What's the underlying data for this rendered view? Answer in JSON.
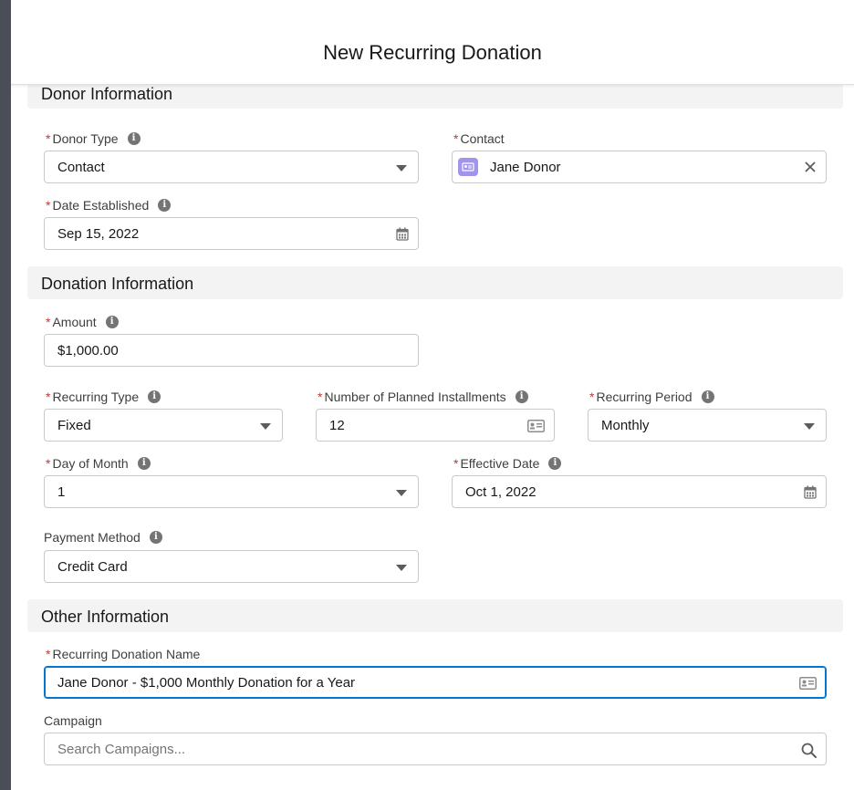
{
  "modal": {
    "title": "New Recurring Donation"
  },
  "sections": {
    "donor": "Donor Information",
    "donation": "Donation Information",
    "other": "Other Information"
  },
  "fields": {
    "donor_type": {
      "label": "Donor Type",
      "value": "Contact"
    },
    "contact": {
      "label": "Contact",
      "value": "Jane Donor"
    },
    "date_established": {
      "label": "Date Established",
      "value": "Sep 15, 2022"
    },
    "amount": {
      "label": "Amount",
      "value": "$1,000.00"
    },
    "recurring_type": {
      "label": "Recurring Type",
      "value": "Fixed"
    },
    "planned_installments": {
      "label": "Number of Planned Installments",
      "value": "12"
    },
    "recurring_period": {
      "label": "Recurring Period",
      "value": "Monthly"
    },
    "day_of_month": {
      "label": "Day of Month",
      "value": "1"
    },
    "effective_date": {
      "label": "Effective Date",
      "value": "Oct 1, 2022"
    },
    "payment_method": {
      "label": "Payment Method",
      "value": "Credit Card"
    },
    "donation_name": {
      "label": "Recurring Donation Name",
      "value": "Jane Donor - $1,000 Monthly Donation for a Year"
    },
    "campaign": {
      "label": "Campaign",
      "placeholder": "Search Campaigns..."
    }
  },
  "required_marker": "*",
  "info_glyph": "i",
  "icons": {
    "dropdown": "chevron-down-icon",
    "calendar": "calendar-icon",
    "contact": "contact-card-icon",
    "clear": "close-icon",
    "text_lookup": "id-card-icon",
    "search": "search-icon"
  },
  "colors": {
    "required": "#c23934",
    "focus": "#0176d3",
    "contact_badge": "#a094ed"
  }
}
